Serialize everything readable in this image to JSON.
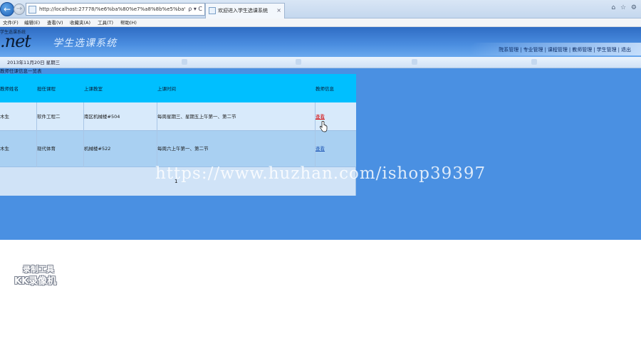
{
  "browser": {
    "address_url": "http://localhost:27778/%e6%ba%80%e7%a8%8b%e5%ba%8f/",
    "address_tools": "ρ ▾ C",
    "tab_title": "欢迎进入学生选课系统",
    "tab_close": "×",
    "system_icons": "⌂ ☆ ⚙"
  },
  "menubar": {
    "items": [
      "文件(F)",
      "编辑(E)",
      "查看(V)",
      "收藏夹(A)",
      "工具(T)",
      "帮助(H)"
    ]
  },
  "header": {
    "logo_small": "学生选课系统",
    "logo": ".net",
    "system_title": "学生选课系统",
    "nav": [
      "院系管理",
      "专业管理",
      "课程管理",
      "教师管理",
      "学生管理",
      "退出"
    ],
    "nav_separator": "|"
  },
  "datebar": {
    "date_text": "2013年11月20日 星期三"
  },
  "list": {
    "title": "教师任课信息一览表",
    "columns": [
      "教师姓名",
      "担任课程",
      "上课教室",
      "上课时间",
      "教师信息"
    ],
    "rows": [
      {
        "teacher": "木生",
        "course": "软件工程二",
        "room": "南区机械楼#504",
        "time": "每周星期三、星期五上午第一、第二节",
        "action": "查看"
      },
      {
        "teacher": "木生",
        "course": "现代体育",
        "room": "机械楼#522",
        "time": "每周六上午第一、第二节",
        "action": "查看"
      }
    ],
    "page": "1"
  },
  "overlay": {
    "watermark": "https://www.huzhan.com/ishop39397",
    "recorder_line1": "录制工具",
    "recorder_line2": "KK录像机"
  },
  "colors": {
    "content_bg": "#4a90e2",
    "table_header": "#00bfff",
    "row_odd": "#d8eafb",
    "row_even": "#a9d0f2",
    "action_active": "#d40000",
    "action_link": "#1f56b5"
  }
}
